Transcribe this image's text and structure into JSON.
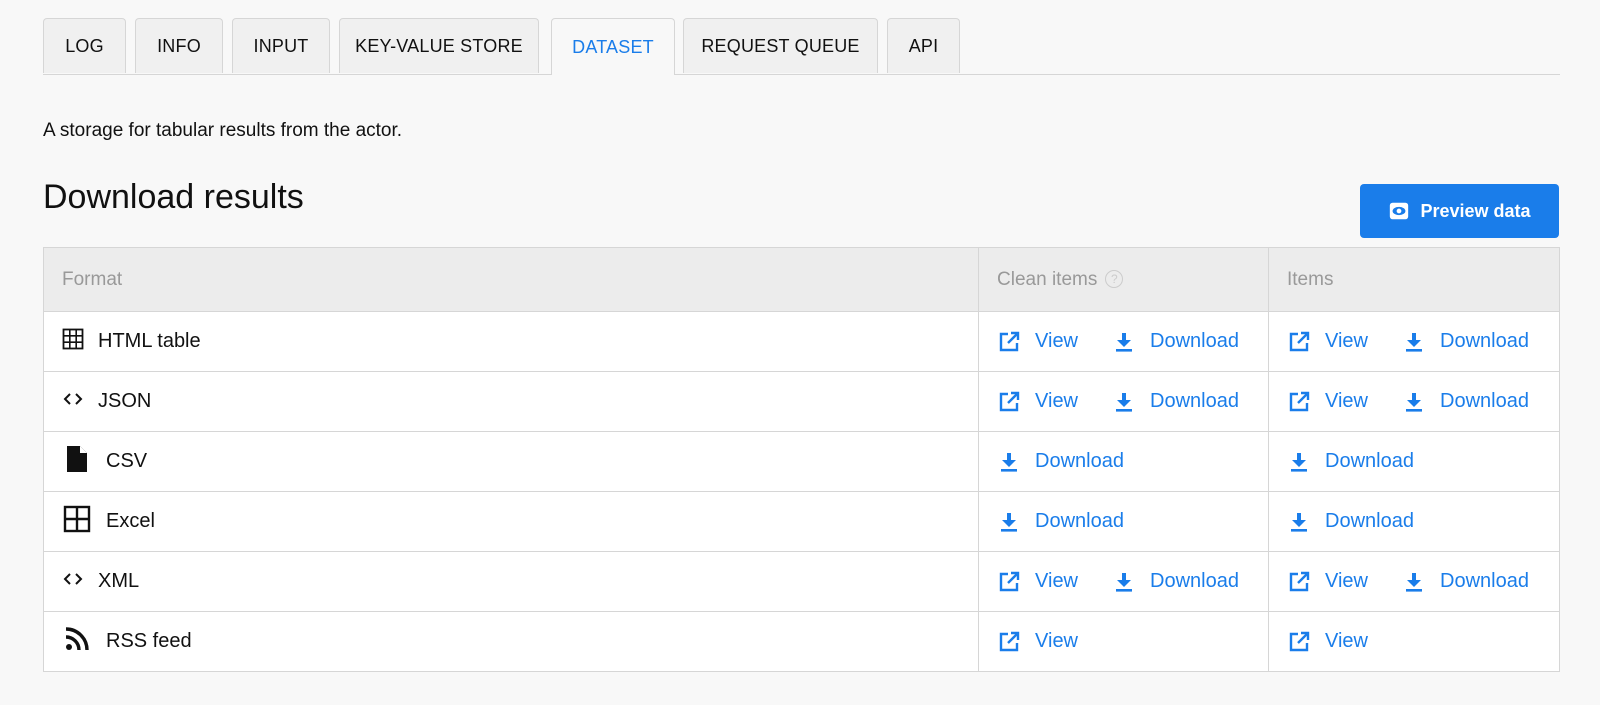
{
  "tabs": [
    "LOG",
    "INFO",
    "INPUT",
    "KEY-VALUE STORE",
    "DATASET",
    "REQUEST QUEUE",
    "API"
  ],
  "active_tab": "DATASET",
  "description": "A storage for tabular results from the actor.",
  "title": "Download results",
  "preview_button": "Preview data",
  "table": {
    "headers": {
      "format": "Format",
      "clean_items": "Clean items",
      "items": "Items"
    },
    "view_label": "View",
    "download_label": "Download",
    "rows": [
      {
        "name": "HTML table",
        "icon": "table-grid-icon",
        "view": true,
        "download": true
      },
      {
        "name": "JSON",
        "icon": "code-icon",
        "view": true,
        "download": true
      },
      {
        "name": "CSV",
        "icon": "file-icon",
        "view": false,
        "download": true
      },
      {
        "name": "Excel",
        "icon": "spreadsheet-icon",
        "view": false,
        "download": true
      },
      {
        "name": "XML",
        "icon": "code-icon",
        "view": true,
        "download": true
      },
      {
        "name": "RSS feed",
        "icon": "rss-icon",
        "view": true,
        "download": false
      }
    ]
  },
  "colors": {
    "accent": "#1a7dea",
    "border": "#d6d6d6",
    "header_bg": "#ececec",
    "page_bg": "#f8f8f8"
  }
}
